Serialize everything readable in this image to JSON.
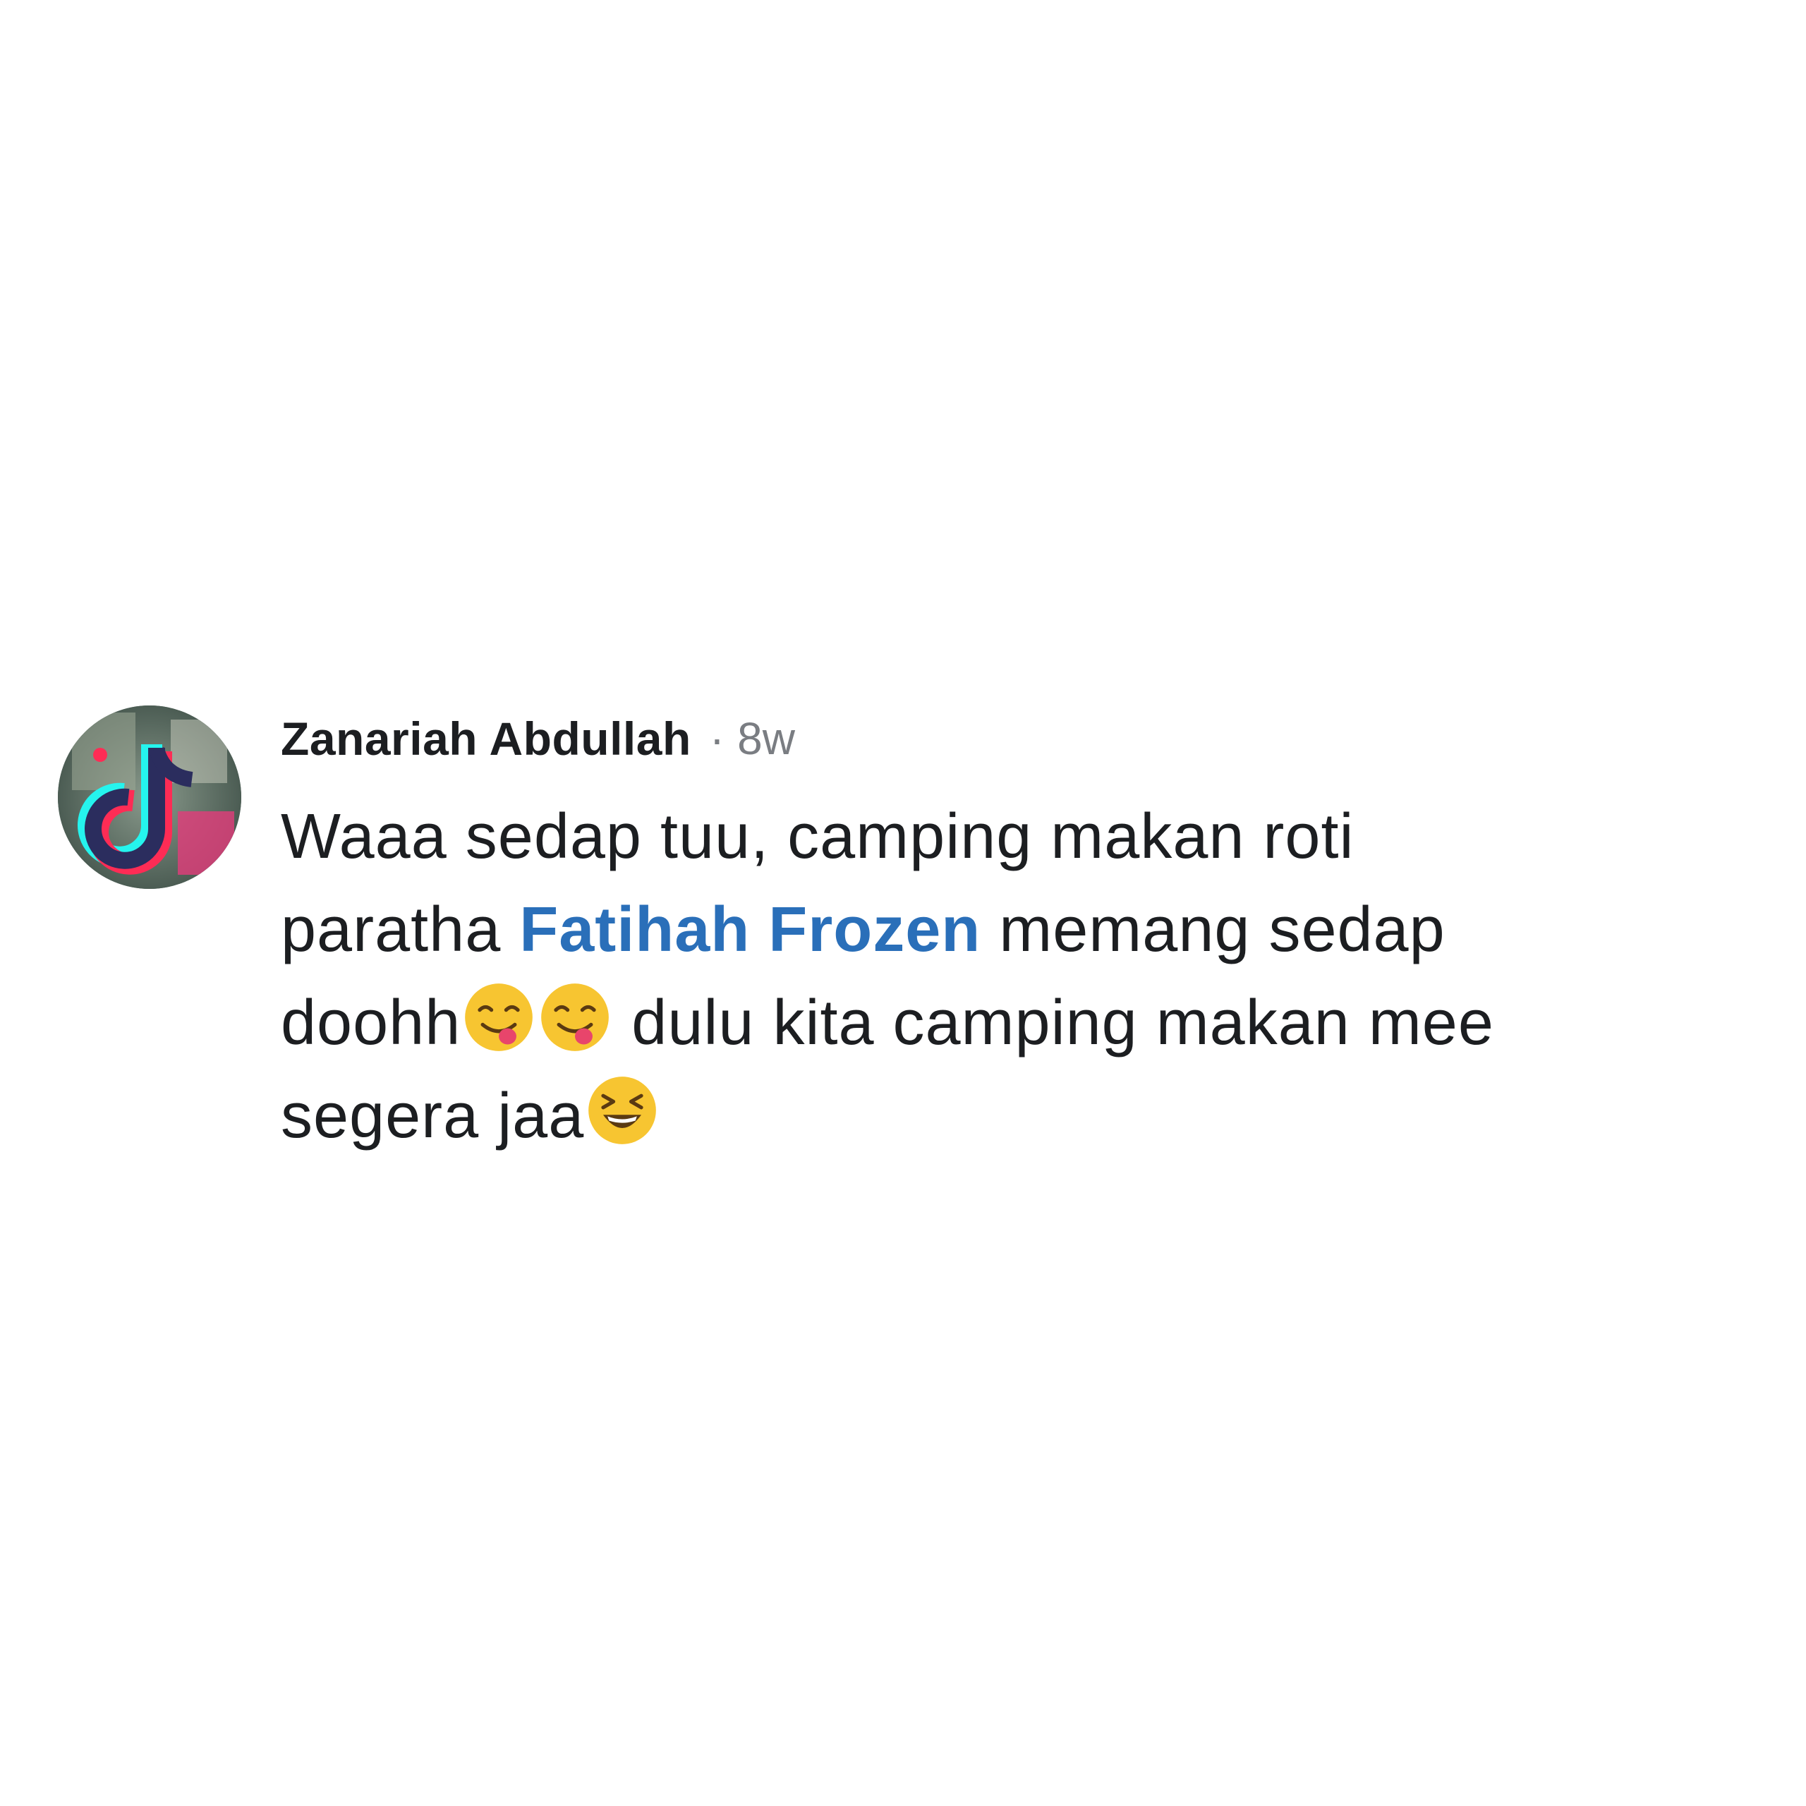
{
  "comment": {
    "author": "Zanariah Abdullah",
    "separator": "·",
    "timestamp": "8w",
    "body": {
      "line1": "Waaa sedap tuu, camping makan roti",
      "line2_prefix": "paratha ",
      "mention": "Fatihah Frozen",
      "line2_suffix": " memang sedap",
      "line3_prefix": "doohh",
      "line3_suffix": " dulu kita camping makan mee",
      "line4_prefix": "segera jaa"
    },
    "emojis": [
      "yum-face-emoji",
      "yum-face-emoji",
      "grinning-squinting-face-emoji"
    ],
    "avatar_icon": "tiktok-logo-icon"
  },
  "colors": {
    "mention": "#2a6fb9",
    "text": "#1c1e21",
    "meta": "#7a7d82",
    "background": "#ffffff"
  }
}
